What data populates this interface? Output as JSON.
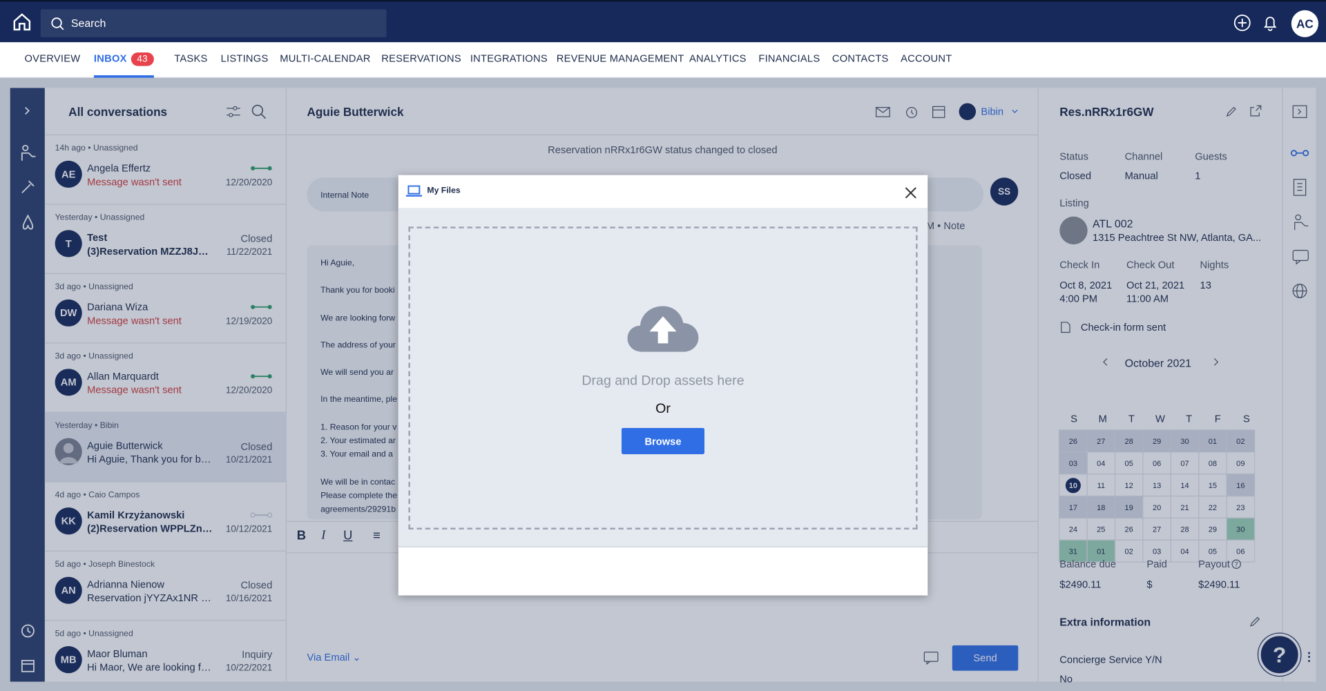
{
  "search": {
    "placeholder": "Search"
  },
  "user": {
    "initials": "AC"
  },
  "nav": {
    "overview": "OVERVIEW",
    "inbox": "INBOX",
    "inbox_count": "43",
    "tasks": "TASKS",
    "listings": "LISTINGS",
    "multicalendar": "MULTI-CALENDAR",
    "reservations": "RESERVATIONS",
    "integrations": "INTEGRATIONS",
    "revenue": "REVENUE MANAGEMENT",
    "analytics": "ANALYTICS",
    "financials": "FINANCIALS",
    "contacts": "CONTACTS",
    "account": "ACCOUNT"
  },
  "conversations": {
    "title": "All conversations",
    "items": [
      {
        "meta": "14h ago • Unassigned",
        "initials": "AE",
        "name": "Angela Effertz",
        "msg": "Message wasn't sent",
        "status": "",
        "date": "12/20/2020"
      },
      {
        "meta": "Yesterday • Unassigned",
        "initials": "T",
        "name": "Test",
        "msg": "(3)Reservation MZZJ8JXm...",
        "status": "Closed",
        "date": "11/22/2021"
      },
      {
        "meta": "3d ago • Unassigned",
        "initials": "DW",
        "name": "Dariana Wiza",
        "msg": "Message wasn't sent",
        "status": "",
        "date": "12/19/2020"
      },
      {
        "meta": "3d ago • Unassigned",
        "initials": "AM",
        "name": "Allan Marquardt",
        "msg": "Message wasn't sent",
        "status": "",
        "date": "12/20/2020"
      },
      {
        "meta": "Yesterday • Bibin",
        "initials": "",
        "name": "Aguie Butterwick",
        "msg": "Hi Aguie, Thank you for bo...",
        "status": "Closed",
        "date": "10/21/2021"
      },
      {
        "meta": "4d ago • Caio Campos",
        "initials": "KK",
        "name": "Kamil Krzyżanowski",
        "msg": "(2)Reservation WPPLZnw...",
        "status": "",
        "date": "10/12/2021"
      },
      {
        "meta": "5d ago • Joseph Binestock",
        "initials": "AN",
        "name": "Adrianna Nienow",
        "msg": "Reservation jYYZAx1NR st...",
        "status": "Closed",
        "date": "10/16/2021"
      },
      {
        "meta": "5d ago • Unassigned",
        "initials": "MB",
        "name": "Maor Bluman",
        "msg": "Hi Maor, We are looking for...",
        "status": "Inquiry",
        "date": "10/22/2021"
      }
    ]
  },
  "chat": {
    "guest": "Aguie Butterwick",
    "assignee": "Bibin",
    "system": "Reservation nRRx1r6GW status changed to closed",
    "internal_note": "Internal Note",
    "ss": "SS",
    "note_meta": "M • Note",
    "email_lines": [
      "Hi Aguie,",
      "Thank you for booki",
      "We are looking forw",
      "The address of your",
      "We will send you ar",
      "In the meantime, ple",
      "1. Reason for your v",
      "2. Your estimated ar",
      "3. Your email and a",
      "We will be in contac",
      "Please complete the",
      "agreements/29291b"
    ],
    "via": "Via Email",
    "send": "Send"
  },
  "details": {
    "res": "Res.nRRx1r6GW",
    "status_label": "Status",
    "status": "Closed",
    "channel_label": "Channel",
    "channel": "Manual",
    "guests_label": "Guests",
    "guests": "1",
    "listing_label": "Listing",
    "listing_name": "ATL 002",
    "listing_addr": "1315 Peachtree St NW, Atlanta, GA...",
    "checkin_label": "Check In",
    "checkin_date": "Oct 8, 2021",
    "checkin_time": "4:00 PM",
    "checkout_label": "Check Out",
    "checkout_date": "Oct 21, 2021",
    "checkout_time": "11:00 AM",
    "nights_label": "Nights",
    "nights": "13",
    "form": "Check-in form sent",
    "month": "October 2021",
    "balance_label": "Balance due",
    "balance": "$2490.11",
    "paid_label": "Paid",
    "paid": "$",
    "payout_label": "Payout",
    "payout": "$2490.11",
    "extra": "Extra information",
    "concierge": "Concierge Service Y/N",
    "concierge_val": "No"
  },
  "calendar": {
    "days": [
      "S",
      "M",
      "T",
      "W",
      "T",
      "F",
      "S"
    ],
    "weeks": [
      [
        "26",
        "27",
        "28",
        "29",
        "30",
        "01",
        "02"
      ],
      [
        "03",
        "04",
        "05",
        "06",
        "07",
        "08",
        "09"
      ],
      [
        "10",
        "11",
        "12",
        "13",
        "14",
        "15",
        "16"
      ],
      [
        "17",
        "18",
        "19",
        "20",
        "21",
        "22",
        "23"
      ],
      [
        "24",
        "25",
        "26",
        "27",
        "28",
        "29",
        "30"
      ],
      [
        "31",
        "01",
        "02",
        "03",
        "04",
        "05",
        "06"
      ]
    ]
  },
  "modal": {
    "title": "My Files",
    "drop_text": "Drag and Drop assets here",
    "or": "Or",
    "browse": "Browse"
  },
  "help": "?"
}
